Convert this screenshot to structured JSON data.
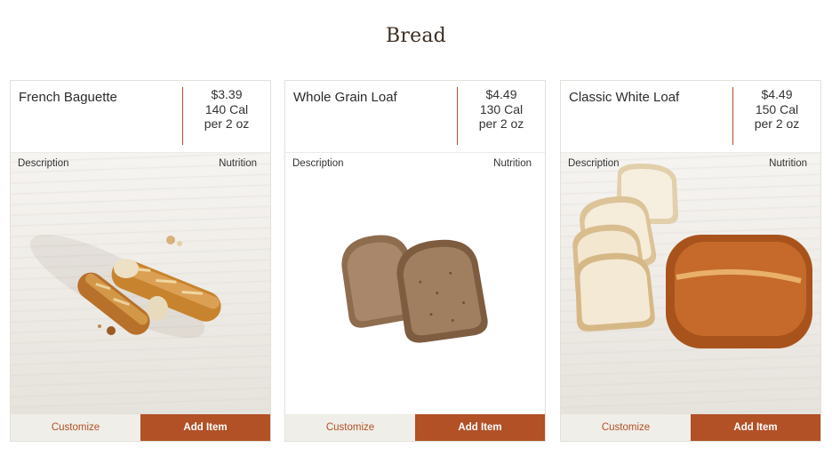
{
  "section": {
    "title": "Bread"
  },
  "tabs": {
    "description": "Description",
    "nutrition": "Nutrition"
  },
  "buttons": {
    "customize": "Customize",
    "add": "Add Item"
  },
  "items": [
    {
      "name": "French Baguette",
      "price": "$3.39",
      "calories": "140 Cal",
      "serving": "per 2 oz",
      "image": "french-baguette-image"
    },
    {
      "name": "Whole Grain Loaf",
      "price": "$4.49",
      "calories": "130 Cal",
      "serving": "per 2 oz",
      "image": "whole-grain-loaf-image"
    },
    {
      "name": "Classic White Loaf",
      "price": "$4.49",
      "calories": "150 Cal",
      "serving": "per 2 oz",
      "image": "classic-white-loaf-image"
    }
  ],
  "colors": {
    "accent": "#b25026",
    "customize_bg": "#f0eee8",
    "title": "#3d2e22"
  }
}
